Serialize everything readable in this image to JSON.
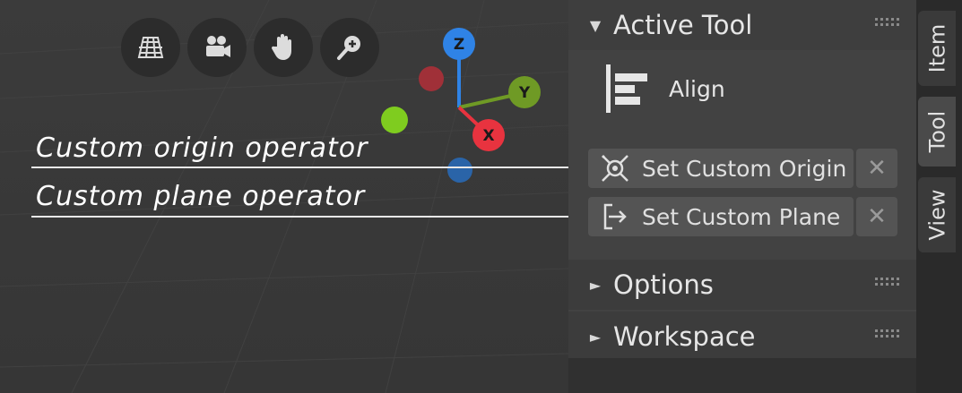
{
  "viewport": {
    "nav_buttons": [
      {
        "name": "grid-view-icon"
      },
      {
        "name": "camera-icon"
      },
      {
        "name": "hand-pan-icon"
      },
      {
        "name": "zoom-icon"
      }
    ],
    "gizmo": {
      "z_label": "Z",
      "y_label": "Y",
      "x_label": "X",
      "colors": {
        "z": "#2f83e6",
        "y": "#6f9a25",
        "x": "#e8333f",
        "neg_x": "#a03038",
        "neg_y": "#7fcc1f",
        "neg_z": "#2a64a8"
      }
    }
  },
  "annotations": {
    "origin": "Custom origin operator",
    "plane": "Custom plane operator"
  },
  "sidebar": {
    "active_tool_header": "Active Tool",
    "active_tool_name": "Align",
    "operators": {
      "origin_label": "Set Custom Origin",
      "plane_label": "Set Custom Plane",
      "remove_symbol": "✕"
    },
    "options_header": "Options",
    "workspace_header": "Workspace",
    "expanded_symbol": "▼",
    "collapsed_symbol": "►"
  },
  "tabs": [
    "Item",
    "Tool",
    "View"
  ]
}
